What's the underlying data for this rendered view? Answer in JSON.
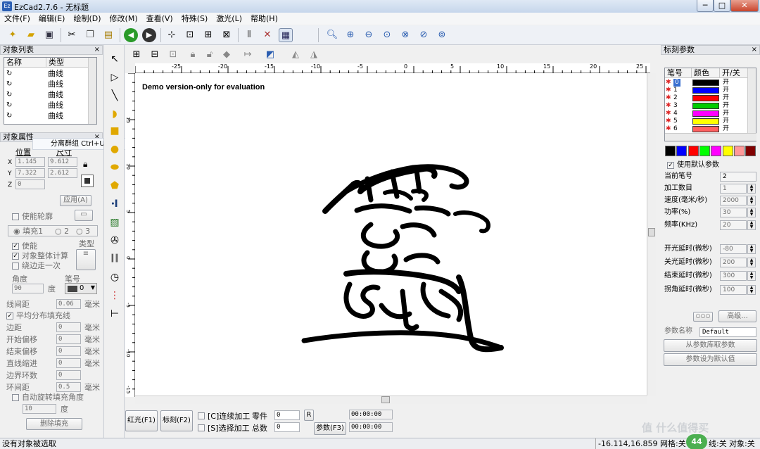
{
  "window": {
    "title": "EzCad2.7.6 - 无标题",
    "app_icon": "Ez",
    "minimize": "─",
    "maximize": "□",
    "close": "✕"
  },
  "menu": [
    "文件(F)",
    "编辑(E)",
    "绘制(D)",
    "修改(M)",
    "查看(V)",
    "特殊(S)",
    "激光(L)",
    "帮助(H)"
  ],
  "toolbar": {
    "icons": [
      "new-icon",
      "open-icon",
      "save-icon",
      "cut-icon",
      "copy-icon",
      "paste-icon",
      "undo-icon",
      "redo-icon",
      "snap-icon",
      "node-icon",
      "node2-icon",
      "node3-icon",
      "hatch-icon",
      "tools-icon",
      "param-icon",
      "zoom-icon",
      "zoom-in-icon",
      "zoom-out-icon",
      "zoom-all-icon",
      "zoom-select-icon",
      "zoom-page-icon",
      "zoom-fit-icon"
    ]
  },
  "object_list": {
    "header": "对象列表",
    "columns": [
      "名称",
      "类型"
    ],
    "rows": [
      {
        "name": "",
        "type": "曲线"
      },
      {
        "name": "",
        "type": "曲线"
      },
      {
        "name": "",
        "type": "曲线"
      },
      {
        "name": "",
        "type": "曲线"
      },
      {
        "name": "",
        "type": "曲线"
      }
    ]
  },
  "object_props": {
    "header": "对象属性",
    "tooltip": "分离群组 Ctrl+U",
    "pos_label": "位置",
    "size_label": "尺寸",
    "x": "1.145",
    "y": "7.322",
    "z": "0",
    "w": "9.612",
    "h": "2.612",
    "x_lbl": "X",
    "y_lbl": "Y",
    "z_lbl": "Z",
    "apply": "应用(A)",
    "enable_outline": "使能轮廓",
    "fill1": "填充1",
    "fill2": "2",
    "fill3": "3",
    "enable": "使能",
    "type_label": "类型",
    "whole_calc": "对象整体计算",
    "edge_once": "绕边走一次",
    "angle_label": "角度",
    "angle": "90",
    "deg": "度",
    "pen_label": "笔号",
    "pen": "0",
    "line_spacing": "线间距",
    "line_spacing_val": "0.06",
    "mm": "毫米",
    "even_fill": "平均分布填充线",
    "margin": "边距",
    "margin_val": "0",
    "start_offset": "开始偏移",
    "start_offset_val": "0",
    "end_offset": "结束偏移",
    "end_offset_val": "0",
    "line_shrink": "直线缩进",
    "line_shrink_val": "0",
    "border_loops": "边界环数",
    "border_loops_val": "0",
    "loop_spacing": "环间距",
    "loop_spacing_val": "0.5",
    "auto_rotate": "自动旋转填充角度",
    "rotate_val": "10",
    "delete_fill": "删除填充"
  },
  "canvas": {
    "demo_text": "Demo version-only for evaluation",
    "ruler_h": [
      "-25",
      "-20",
      "-15",
      "-10",
      "-5",
      "0",
      "5",
      "10",
      "15",
      "20",
      "25"
    ],
    "ruler_v": [
      "15",
      "10",
      "5",
      "0",
      "-5",
      "-10",
      "-15"
    ]
  },
  "bottom": {
    "red_light": "红光(F1)",
    "mark": "标刻(F2)",
    "continuous": "[C]连续加工",
    "parts": "零件",
    "parts_val": "0",
    "r_btn": "R",
    "select_process": "[S]选择加工",
    "total": "总数",
    "total_val": "0",
    "params": "参数(F3)",
    "time1": "00:00:00",
    "time2": "00:00:00"
  },
  "marking_params": {
    "header": "标刻参数",
    "columns": [
      "笔号",
      "颜色",
      "开/关"
    ],
    "pens": [
      {
        "no": "0",
        "color": "#000000",
        "state": "开"
      },
      {
        "no": "1",
        "color": "#0000ff",
        "state": "开"
      },
      {
        "no": "2",
        "color": "#ff0000",
        "state": "开"
      },
      {
        "no": "3",
        "color": "#00cc00",
        "state": "开"
      },
      {
        "no": "4",
        "color": "#ff00ff",
        "state": "开"
      },
      {
        "no": "5",
        "color": "#ffff00",
        "state": "开"
      },
      {
        "no": "6",
        "color": "#ff6060",
        "state": "开"
      }
    ],
    "palette": [
      "#000000",
      "#0000ff",
      "#ff0000",
      "#00ff00",
      "#ff00ff",
      "#ffff00",
      "#ff9999",
      "#800000"
    ],
    "use_default": "使用默认参数",
    "current_pen": "当前笔号",
    "current_pen_val": "2",
    "count": "加工数目",
    "count_val": "1",
    "speed": "速度(毫米/秒)",
    "speed_val": "2000",
    "power": "功率(%)",
    "power_val": "30",
    "freq": "频率(KHz)",
    "freq_val": "20",
    "on_delay": "开光延时(微秒)",
    "on_delay_val": "-80",
    "off_delay": "关光延时(微秒)",
    "off_delay_val": "200",
    "end_delay": "结束延时(微秒)",
    "end_delay_val": "300",
    "corner_delay": "拐角延时(微秒)",
    "corner_delay_val": "100",
    "advanced": "高级...",
    "param_name": "参数名称",
    "param_name_val": "Default",
    "load_lib": "从参数库取参数",
    "set_default": "参数设为默认值"
  },
  "status": {
    "message": "没有对象被选取",
    "coords": "-16.114,16.859",
    "grid": "网格:关",
    "badge": "44",
    "guide": "线:关",
    "snap": "对象:关"
  },
  "watermark": "值 什么值得买"
}
